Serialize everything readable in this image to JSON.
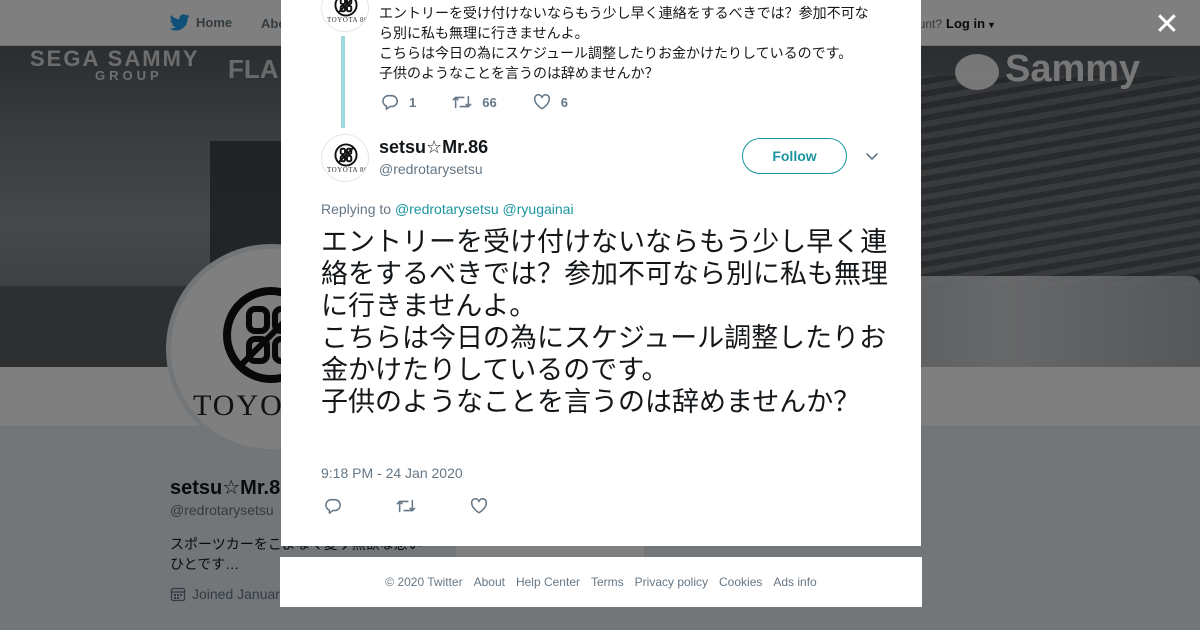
{
  "nav": {
    "home_label": "Home",
    "about_label": "Abo",
    "account_prompt": "ccount?",
    "login_label": "Log in"
  },
  "banner": {
    "text_left_1": "SEGA SAMMY",
    "text_left_2": "GROUP",
    "text_left_3": "FLA",
    "text_right": "Sammy"
  },
  "profile": {
    "avatar_brand": "TOYOT",
    "name": "setsu☆Mr.8",
    "handle": "@redrotarysetsu",
    "bio": "スポーツカーをこよなく愛す無欲な悪いひとです…",
    "joined": "Joined Januar"
  },
  "previous_tweet": {
    "text": "エントリーを受け付けないならもう少し早く連絡をするべきでは？参加不可なら別に私も無理に行きませんよ。\nこちらは今日の為にスケジュール調整したりお金かけたりしているのです。\n子供のようなことを言うのは辞めませんか？",
    "replies": "1",
    "retweets": "66",
    "likes": "6"
  },
  "tweet": {
    "avatar_brand": "TOYOTA 86",
    "author_name": "setsu☆Mr.86",
    "author_handle": "@redrotarysetsu",
    "follow_label": "Follow",
    "replying_prefix": "Replying to",
    "reply_to_1": "@redrotarysetsu",
    "reply_to_2": "@ryugainai",
    "text": "エントリーを受け付けないならもう少し早く連絡をするべきでは？参加不可なら別に私も無理に行きませんよ。\nこちらは今日の為にスケジュール調整したりお金かけたりしているのです。\n子供のようなことを言うのは辞めませんか？",
    "timestamp": "9:18 PM - 24 Jan 2020"
  },
  "icons": {
    "close": "close-icon",
    "reply": "reply-icon",
    "retweet": "retweet-icon",
    "like": "heart-icon",
    "caret": "chevron-down-icon",
    "twitter": "twitter-bird-icon",
    "calendar": "calendar-icon"
  },
  "colors": {
    "accent": "#1b95a0",
    "thread_line": "#9fd9e0",
    "muted_text": "#657786",
    "overlay": "rgba(0,0,0,0.5)"
  },
  "footer": {
    "copyright": "© 2020 Twitter",
    "links": [
      "About",
      "Help Center",
      "Terms",
      "Privacy policy",
      "Cookies",
      "Ads info"
    ]
  }
}
